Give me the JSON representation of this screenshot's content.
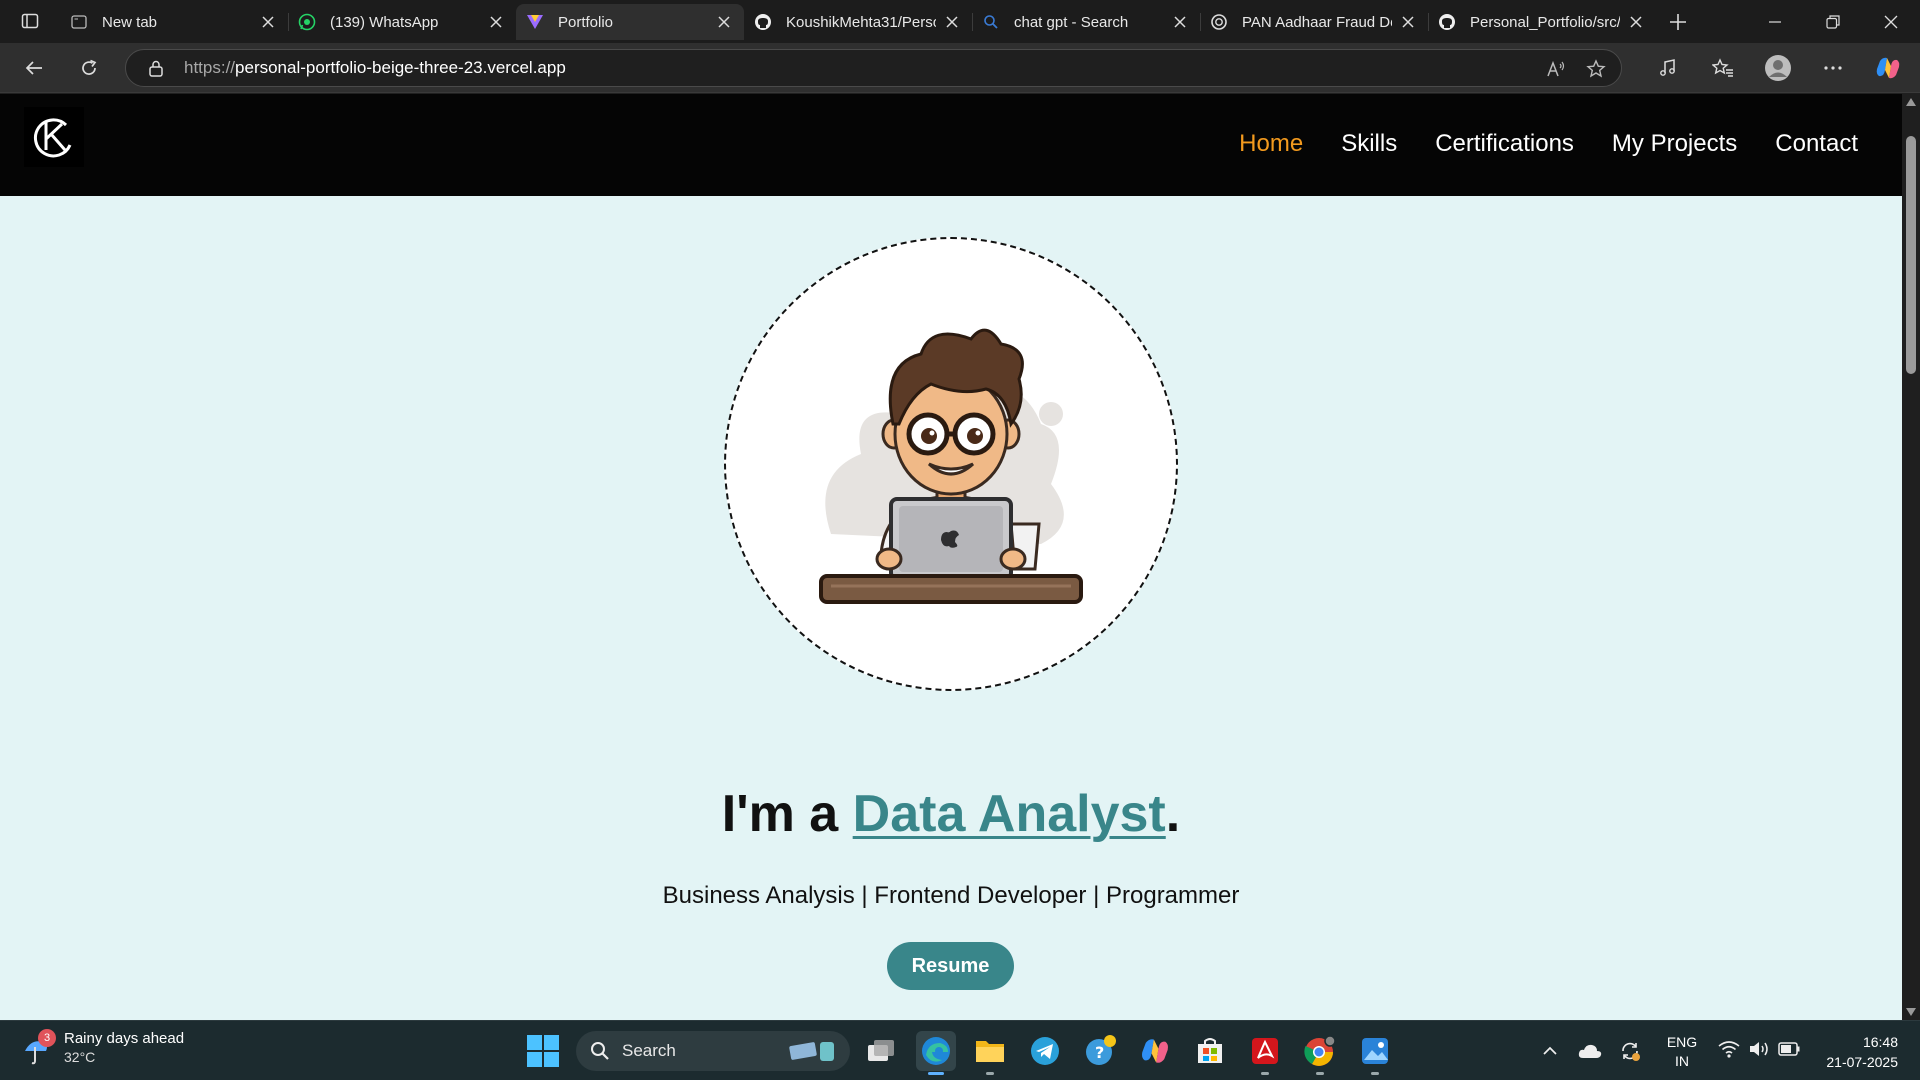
{
  "browser": {
    "tabs": [
      {
        "title": "New tab",
        "icon": "new-tab-page-icon",
        "active": false
      },
      {
        "title": "(139) WhatsApp",
        "icon": "whatsapp-icon",
        "active": false
      },
      {
        "title": "Portfolio",
        "icon": "vercel-icon",
        "active": true
      },
      {
        "title": "KoushikMehta31/Perso",
        "icon": "github-icon",
        "active": false
      },
      {
        "title": "chat gpt - Search",
        "icon": "bing-search-icon",
        "active": false
      },
      {
        "title": "PAN Aadhaar Fraud De",
        "icon": "openai-icon",
        "active": false
      },
      {
        "title": "Personal_Portfolio/src/",
        "icon": "github-icon",
        "active": false
      }
    ],
    "url": {
      "protocol": "https://",
      "host": "personal-portfolio-beige-three-23.vercel.app"
    }
  },
  "site": {
    "nav": [
      {
        "label": "Home",
        "current": true
      },
      {
        "label": "Skills",
        "current": false
      },
      {
        "label": "Certifications",
        "current": false
      },
      {
        "label": "My Projects",
        "current": false
      },
      {
        "label": "Contact",
        "current": false
      }
    ],
    "headline_prefix": "I'm a ",
    "headline_role": "Data Analyst",
    "headline_suffix": ".",
    "subtitle": "Business Analysis | Frontend Developer | Programmer",
    "resume_label": "Resume",
    "colors": {
      "accent": "#39868a",
      "nav_current": "#f39a1e",
      "background": "#e3f4f5"
    }
  },
  "taskbar": {
    "weather": {
      "title": "Rainy days ahead",
      "temp": "32°C",
      "badge": "3"
    },
    "search_label": "Search",
    "language": {
      "line1": "ENG",
      "line2": "IN"
    },
    "clock": {
      "time": "16:48",
      "date": "21-07-2025"
    },
    "pinned": [
      "task-view-icon",
      "edge-icon",
      "file-explorer-icon",
      "telegram-icon",
      "helper-app-icon",
      "copilot-icon",
      "microsoft-store-icon",
      "acrobat-icon",
      "chrome-icon",
      "photos-icon"
    ]
  }
}
